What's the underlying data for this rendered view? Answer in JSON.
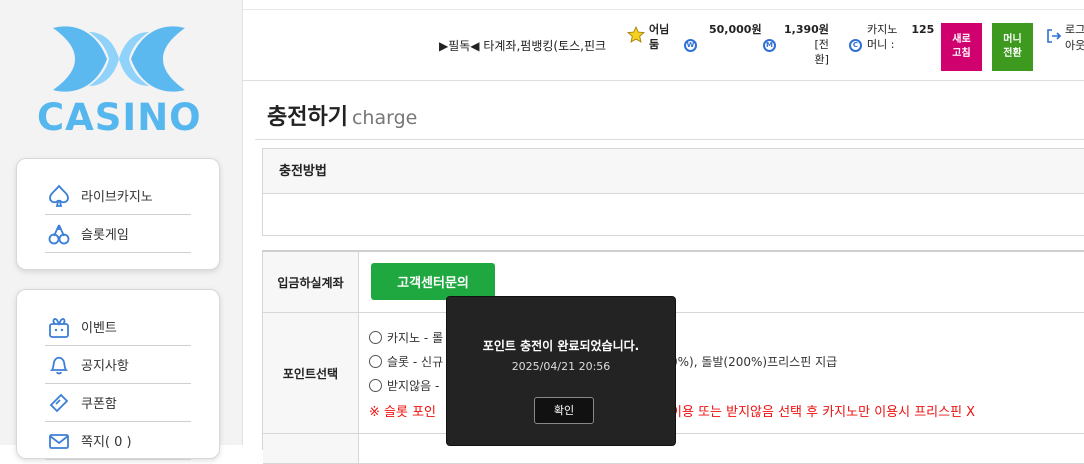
{
  "logo": {
    "text": "CASINO"
  },
  "sidebar": {
    "group1": [
      {
        "label": "라이브카지노",
        "icon": "spade-icon"
      },
      {
        "label": "슬롯게임",
        "icon": "cherry-icon"
      }
    ],
    "group2": [
      {
        "label": "이벤트",
        "icon": "gift-icon"
      },
      {
        "label": "공지사항",
        "icon": "bell-icon"
      },
      {
        "label": "쿠폰함",
        "icon": "coupon-icon"
      },
      {
        "label": "쪽지( 0 )",
        "icon": "mail-icon"
      }
    ]
  },
  "header": {
    "notice": "▶필독◀ 타계좌,펌뱅킹(토스,핀크",
    "username": "어님\n둠",
    "money": {
      "value": "50,000원",
      "coin": "W"
    },
    "mileage": {
      "value": "1,390원",
      "note": "[전\n환]",
      "coin": "M"
    },
    "casino_money": {
      "label": "카지노\n머니 :",
      "value": "125",
      "coin": "C"
    },
    "refresh_label": "새로\n고침",
    "convert_label": "머니\n전환",
    "logout_label": "로그\n아웃",
    "colors": {
      "refresh": "#d0006f",
      "convert": "#3d9a1f"
    }
  },
  "page": {
    "title": "충전하기",
    "subtitle": "charge"
  },
  "method": {
    "heading": "충전방법"
  },
  "form": {
    "account_label": "입금하실계좌",
    "cs_button": "고객센터문의",
    "point_label": "포인트선택",
    "options": [
      "카지노 - 롤",
      "슬롯 - 신규",
      "받지않음 -"
    ],
    "option2_tail": "0%), 돌발(200%)프리스핀 지급",
    "warning_head": "※ 슬롯 포인",
    "warning_tail": "이용 또는 받지않음 선택 후 카지노만 이용시 프리스핀 X"
  },
  "modal": {
    "message": "포인트 충전이 완료되었습니다.",
    "timestamp": "2025/04/21 20:56",
    "ok_label": "확인"
  }
}
